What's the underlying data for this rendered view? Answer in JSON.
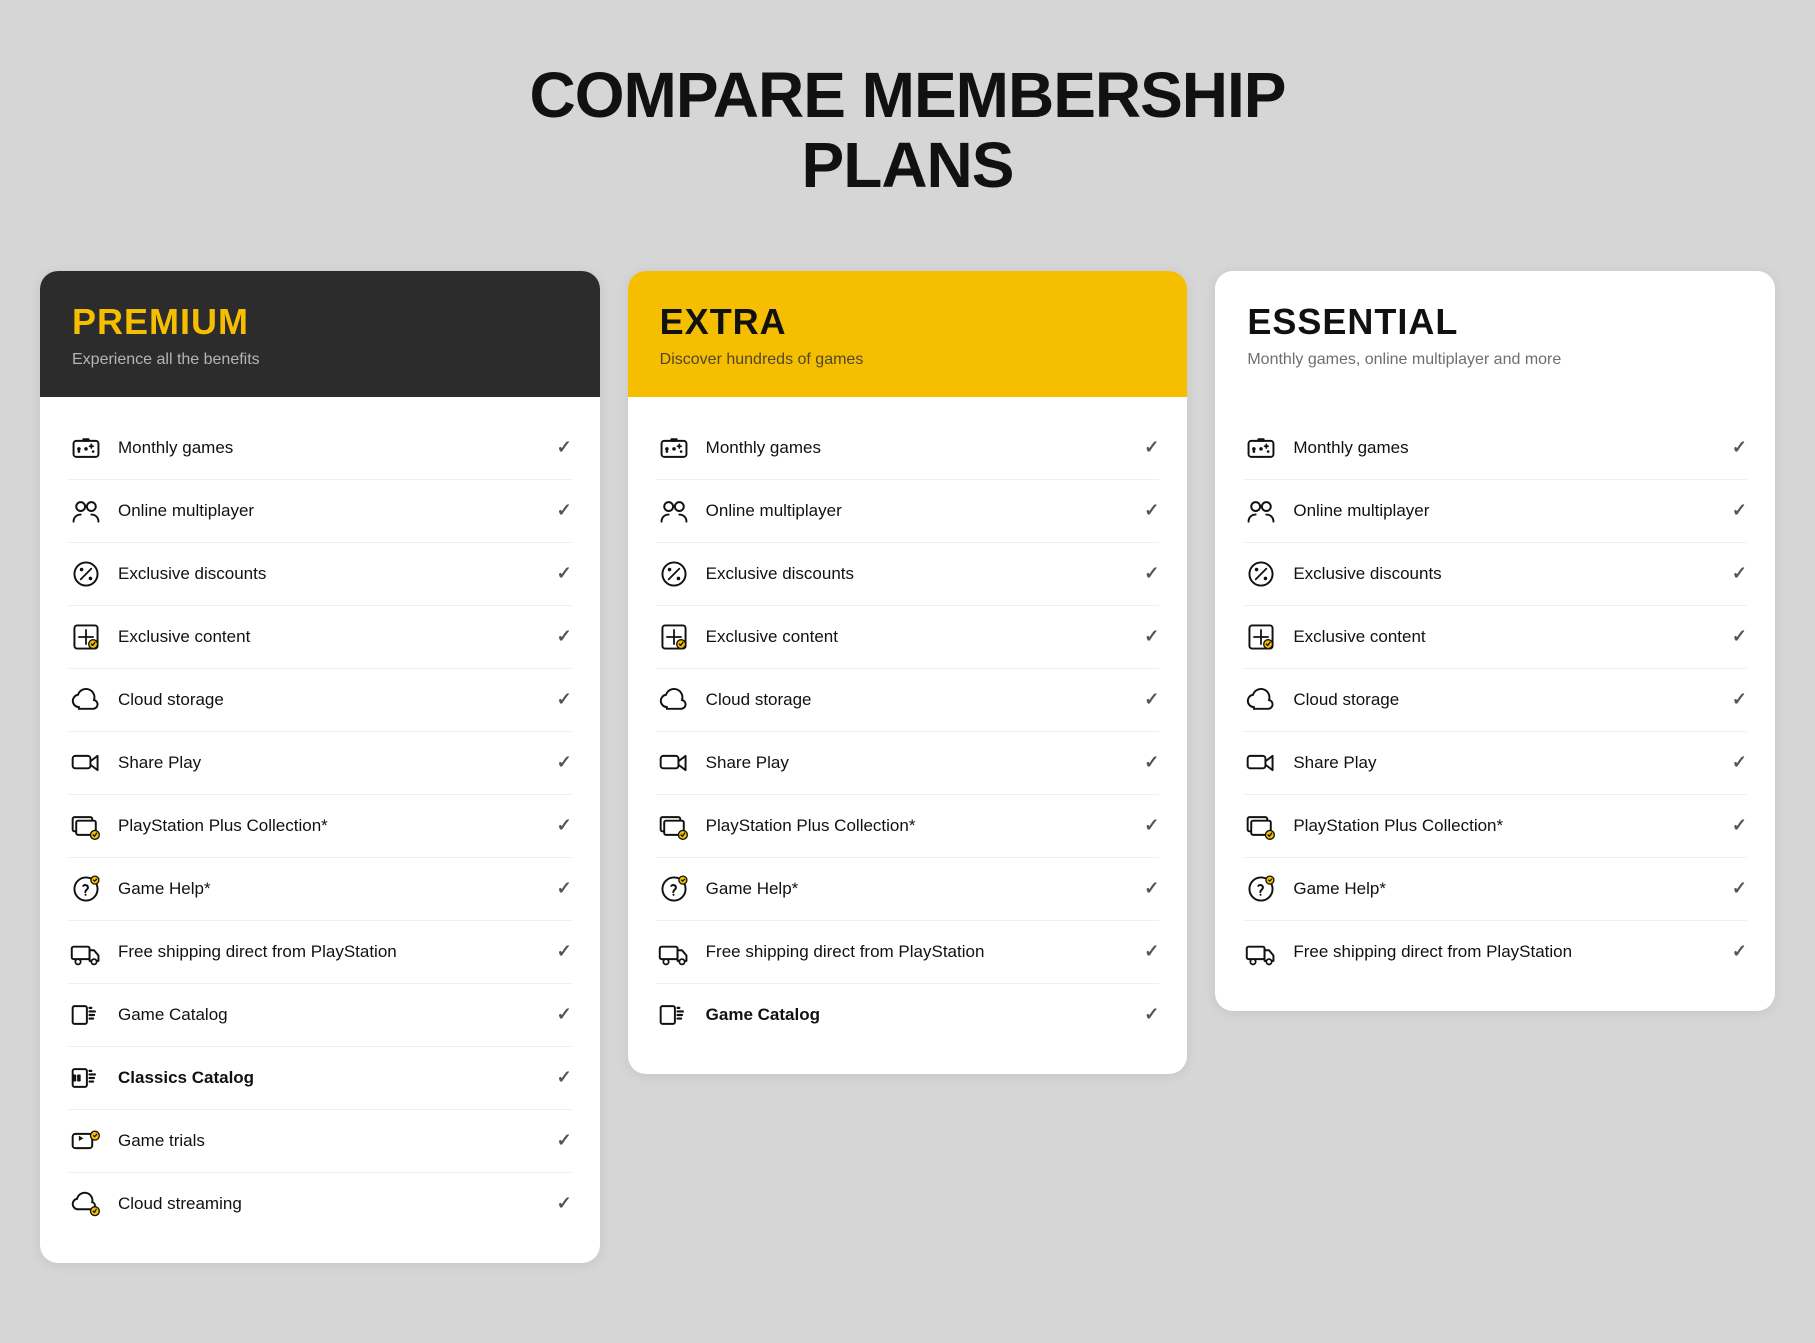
{
  "page": {
    "title_line1": "COMPARE MEMBERSHIP",
    "title_line2": "PLANS"
  },
  "plans": [
    {
      "id": "premium",
      "headerClass": "premium",
      "name": "PREMIUM",
      "subtitle": "Experience all the benefits",
      "features": [
        {
          "id": "monthly-games",
          "label": "Monthly games",
          "bold": false,
          "icon": "monthly-games"
        },
        {
          "id": "online-multiplayer",
          "label": "Online multiplayer",
          "bold": false,
          "icon": "online-multiplayer"
        },
        {
          "id": "exclusive-discounts",
          "label": "Exclusive discounts",
          "bold": false,
          "icon": "exclusive-discounts"
        },
        {
          "id": "exclusive-content",
          "label": "Exclusive content",
          "bold": false,
          "icon": "exclusive-content"
        },
        {
          "id": "cloud-storage",
          "label": "Cloud storage",
          "bold": false,
          "icon": "cloud-storage"
        },
        {
          "id": "share-play",
          "label": "Share Play",
          "bold": false,
          "icon": "share-play"
        },
        {
          "id": "ps-collection",
          "label": "PlayStation Plus Collection*",
          "bold": false,
          "icon": "ps-collection"
        },
        {
          "id": "game-help",
          "label": "Game Help*",
          "bold": false,
          "icon": "game-help"
        },
        {
          "id": "free-shipping",
          "label": "Free shipping direct from PlayStation",
          "bold": false,
          "icon": "free-shipping"
        },
        {
          "id": "game-catalog",
          "label": "Game Catalog",
          "bold": false,
          "icon": "game-catalog"
        },
        {
          "id": "classics-catalog",
          "label": "Classics Catalog",
          "bold": true,
          "icon": "classics-catalog"
        },
        {
          "id": "game-trials",
          "label": "Game trials",
          "bold": false,
          "icon": "game-trials"
        },
        {
          "id": "cloud-streaming",
          "label": "Cloud streaming",
          "bold": false,
          "icon": "cloud-streaming"
        }
      ]
    },
    {
      "id": "extra",
      "headerClass": "extra",
      "name": "EXTRA",
      "subtitle": "Discover hundreds of games",
      "features": [
        {
          "id": "monthly-games",
          "label": "Monthly games",
          "bold": false,
          "icon": "monthly-games"
        },
        {
          "id": "online-multiplayer",
          "label": "Online multiplayer",
          "bold": false,
          "icon": "online-multiplayer"
        },
        {
          "id": "exclusive-discounts",
          "label": "Exclusive discounts",
          "bold": false,
          "icon": "exclusive-discounts"
        },
        {
          "id": "exclusive-content",
          "label": "Exclusive content",
          "bold": false,
          "icon": "exclusive-content"
        },
        {
          "id": "cloud-storage",
          "label": "Cloud storage",
          "bold": false,
          "icon": "cloud-storage"
        },
        {
          "id": "share-play",
          "label": "Share Play",
          "bold": false,
          "icon": "share-play"
        },
        {
          "id": "ps-collection",
          "label": "PlayStation Plus Collection*",
          "bold": false,
          "icon": "ps-collection"
        },
        {
          "id": "game-help",
          "label": "Game Help*",
          "bold": false,
          "icon": "game-help"
        },
        {
          "id": "free-shipping",
          "label": "Free shipping direct from PlayStation",
          "bold": false,
          "icon": "free-shipping"
        },
        {
          "id": "game-catalog",
          "label": "Game Catalog",
          "bold": true,
          "icon": "game-catalog"
        }
      ]
    },
    {
      "id": "essential",
      "headerClass": "essential",
      "name": "ESSENTIAL",
      "subtitle": "Monthly games, online multiplayer and more",
      "features": [
        {
          "id": "monthly-games",
          "label": "Monthly games",
          "bold": false,
          "icon": "monthly-games"
        },
        {
          "id": "online-multiplayer",
          "label": "Online multiplayer",
          "bold": false,
          "icon": "online-multiplayer"
        },
        {
          "id": "exclusive-discounts",
          "label": "Exclusive discounts",
          "bold": false,
          "icon": "exclusive-discounts"
        },
        {
          "id": "exclusive-content",
          "label": "Exclusive content",
          "bold": false,
          "icon": "exclusive-content"
        },
        {
          "id": "cloud-storage",
          "label": "Cloud storage",
          "bold": false,
          "icon": "cloud-storage"
        },
        {
          "id": "share-play",
          "label": "Share Play",
          "bold": false,
          "icon": "share-play"
        },
        {
          "id": "ps-collection",
          "label": "PlayStation Plus Collection*",
          "bold": false,
          "icon": "ps-collection"
        },
        {
          "id": "game-help",
          "label": "Game Help*",
          "bold": false,
          "icon": "game-help"
        },
        {
          "id": "free-shipping",
          "label": "Free shipping direct from PlayStation",
          "bold": false,
          "icon": "free-shipping"
        }
      ]
    }
  ]
}
